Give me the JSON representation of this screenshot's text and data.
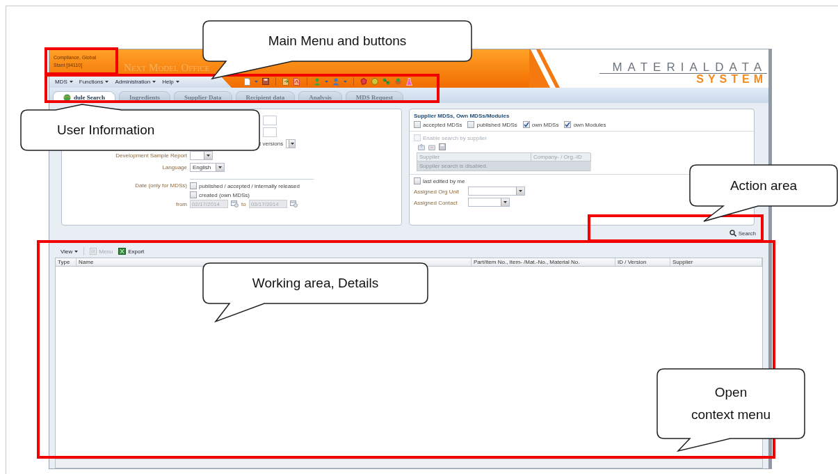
{
  "header": {
    "user_info": [
      "Compliance, Global",
      "Stant [94110]"
    ],
    "app_title": "Next Model Office",
    "logo_top": "MATERIALDATA",
    "logo_bottom": "SYSTEM"
  },
  "menu": [
    {
      "label": "MDS"
    },
    {
      "label": "Functions"
    },
    {
      "label": "Administration"
    },
    {
      "label": "Help"
    }
  ],
  "tabs": [
    {
      "label": "dule Search",
      "selected": true
    },
    {
      "label": "Ingredients",
      "selected": false
    },
    {
      "label": "Supplier Data",
      "selected": false
    },
    {
      "label": "Recipient data",
      "selected": false
    },
    {
      "label": "Analysis",
      "selected": false
    },
    {
      "label": "MDS Request",
      "selected": false
    }
  ],
  "search_form": {
    "rows": [
      {
        "kind": "input"
      },
      {
        "kind": "input"
      },
      {
        "kind": "tail_select",
        "text": "t versions"
      },
      {
        "kind": "select",
        "label": "Development Sample Report"
      },
      {
        "kind": "select",
        "label": "Language",
        "value": "English"
      },
      {
        "kind": "checks",
        "label": "Date (only for MDSs)",
        "options": [
          {
            "label": "published / accepted / internally released",
            "checked": false
          },
          {
            "label": "created (own MDSs)",
            "checked": false
          }
        ]
      },
      {
        "kind": "dates",
        "label": "from",
        "from": "02/17/2014",
        "to_label": "to",
        "to": "03/17/2014",
        "disabled": true
      }
    ]
  },
  "supplier_filter": {
    "title": "Supplier MDSs, Own MDSs/Modules",
    "options": [
      {
        "label": "accepted MDSs",
        "checked": false
      },
      {
        "label": "published MDSs",
        "checked": false
      },
      {
        "label": "own MDSs",
        "checked": true
      },
      {
        "label": "own Modules",
        "checked": true
      }
    ],
    "enable_supplier": {
      "label": "Enable search by supplier",
      "checked": false,
      "disabled": true
    },
    "supplier_table": {
      "columns": [
        "Supplier",
        "Company- / Org.-ID"
      ],
      "message": "Supplier search is disabled."
    },
    "last_edited": {
      "label": "last edited by me",
      "checked": false
    },
    "assigned": [
      {
        "label": "Assigned Org Unit"
      },
      {
        "label": "Assigned Contact"
      }
    ]
  },
  "search_button": "Search",
  "results": {
    "toolbar": [
      {
        "label": "View",
        "kind": "dropdown",
        "disabled": false
      },
      {
        "label": "Menu",
        "kind": "menu",
        "disabled": true
      },
      {
        "label": "Export",
        "kind": "export",
        "disabled": false
      }
    ],
    "columns": [
      "Type",
      "Name",
      "Part/Item No., Item- /Mat.-No., Material No.",
      "ID / Version",
      "Supplier"
    ]
  },
  "callouts": [
    {
      "lines": [
        "Main Menu and buttons"
      ]
    },
    {
      "lines": [
        "User Information"
      ]
    },
    {
      "lines": [
        "Action area"
      ]
    },
    {
      "lines": [
        "Working area, Details"
      ]
    },
    {
      "lines": [
        "Open",
        "context menu"
      ]
    }
  ]
}
